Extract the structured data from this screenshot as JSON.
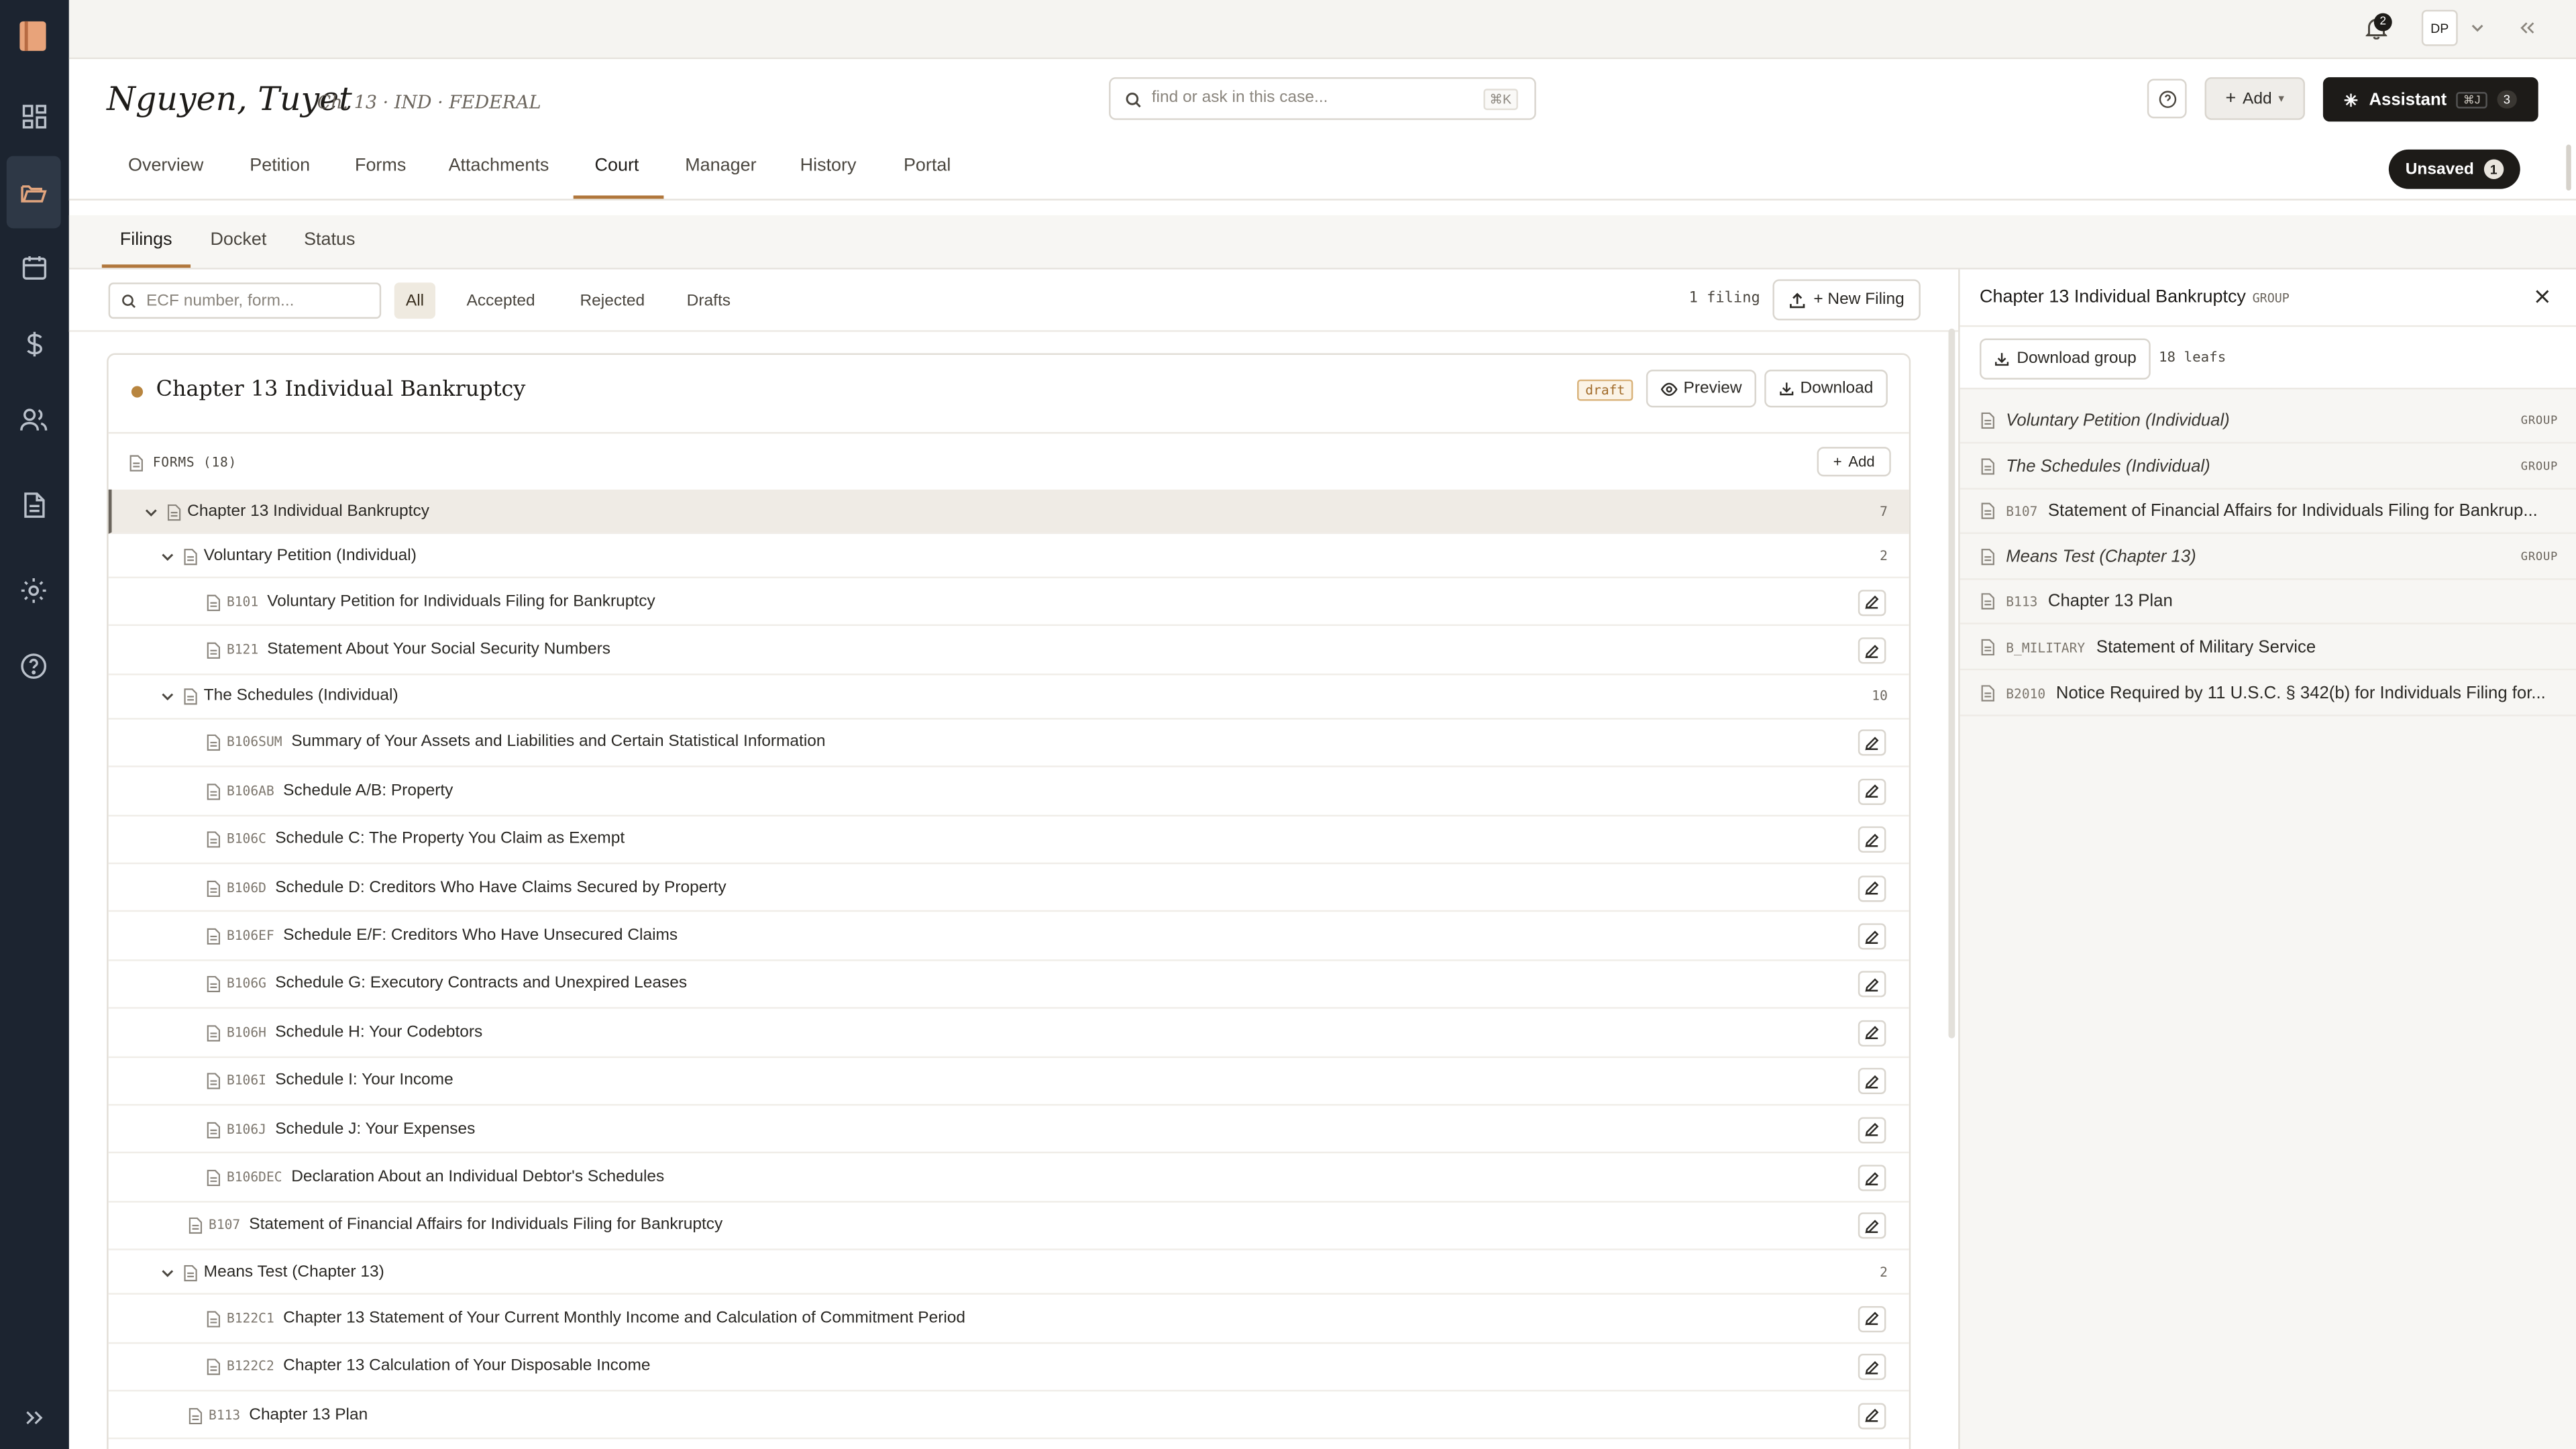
{
  "notifications": {
    "count": "2"
  },
  "user": {
    "initials": "DP"
  },
  "case": {
    "name": "Nguyen, Tuyet",
    "subtitle": "Ch. 13 · IND · FEDERAL"
  },
  "search": {
    "placeholder": "find or ask in this case...",
    "shortcut": "⌘K"
  },
  "header": {
    "add_label": "Add",
    "assistant_label": "Assistant",
    "assistant_shortcut": "⌘J",
    "assistant_count": "3",
    "unsaved_label": "Unsaved",
    "unsaved_count": "1"
  },
  "tabs": [
    "Overview",
    "Petition",
    "Forms",
    "Attachments",
    "Court",
    "Manager",
    "History",
    "Portal"
  ],
  "active_tab": "Court",
  "subtabs": [
    "Filings",
    "Docket",
    "Status"
  ],
  "active_subtab": "Filings",
  "filters": {
    "placeholder": "ECF number, form...",
    "options": [
      "All",
      "Accepted",
      "Rejected",
      "Drafts"
    ],
    "active": "All",
    "count": "1 filing",
    "new_filing": "+ New Filing"
  },
  "filing": {
    "title": "Chapter 13 Individual Bankruptcy",
    "status": "draft",
    "preview_label": "Preview",
    "download_label": "Download",
    "forms_header": "FORMS (18)",
    "add_label": "Add"
  },
  "tree": [
    {
      "level": 0,
      "type": "group",
      "label": "Chapter 13 Individual Bankruptcy",
      "count": "7",
      "selected": true
    },
    {
      "level": 1,
      "type": "group",
      "label": "Voluntary Petition (Individual)",
      "count": "2"
    },
    {
      "level": 2,
      "type": "leaf",
      "code": "B101",
      "label": "Voluntary Petition for Individuals Filing for Bankruptcy"
    },
    {
      "level": 2,
      "type": "leaf",
      "code": "B121",
      "label": "Statement About Your Social Security Numbers"
    },
    {
      "level": 1,
      "type": "group",
      "label": "The Schedules (Individual)",
      "count": "10"
    },
    {
      "level": 2,
      "type": "leaf",
      "code": "B106SUM",
      "label": "Summary of Your Assets and Liabilities and Certain Statistical Information"
    },
    {
      "level": 2,
      "type": "leaf",
      "code": "B106AB",
      "label": "Schedule A/B: Property"
    },
    {
      "level": 2,
      "type": "leaf",
      "code": "B106C",
      "label": "Schedule C: The Property You Claim as Exempt"
    },
    {
      "level": 2,
      "type": "leaf",
      "code": "B106D",
      "label": "Schedule D: Creditors Who Have Claims Secured by Property"
    },
    {
      "level": 2,
      "type": "leaf",
      "code": "B106EF",
      "label": "Schedule E/F: Creditors Who Have Unsecured Claims"
    },
    {
      "level": 2,
      "type": "leaf",
      "code": "B106G",
      "label": "Schedule G: Executory Contracts and Unexpired Leases"
    },
    {
      "level": 2,
      "type": "leaf",
      "code": "B106H",
      "label": "Schedule H: Your Codebtors"
    },
    {
      "level": 2,
      "type": "leaf",
      "code": "B106I",
      "label": "Schedule I: Your Income"
    },
    {
      "level": 2,
      "type": "leaf",
      "code": "B106J",
      "label": "Schedule J: Your Expenses"
    },
    {
      "level": 2,
      "type": "leaf",
      "code": "B106DEC",
      "label": "Declaration About an Individual Debtor's Schedules"
    },
    {
      "level": 1,
      "type": "leaf",
      "code": "B107",
      "label": "Statement of Financial Affairs for Individuals Filing for Bankruptcy"
    },
    {
      "level": 1,
      "type": "group",
      "label": "Means Test (Chapter 13)",
      "count": "2"
    },
    {
      "level": 2,
      "type": "leaf",
      "code": "B122C1",
      "label": "Chapter 13 Statement of Your Current Monthly Income and Calculation of Commitment Period"
    },
    {
      "level": 2,
      "type": "leaf",
      "code": "B122C2",
      "label": "Chapter 13 Calculation of Your Disposable Income"
    },
    {
      "level": 1,
      "type": "leaf",
      "code": "B113",
      "label": "Chapter 13 Plan"
    }
  ],
  "panel": {
    "title": "Chapter 13 Individual Bankruptcy",
    "tag": "GROUP",
    "download_group": "Download group",
    "leafs": "18 leafs",
    "items": [
      {
        "type": "group",
        "label": "Voluntary Petition (Individual)",
        "tag": "GROUP"
      },
      {
        "type": "group",
        "label": "The Schedules (Individual)",
        "tag": "GROUP"
      },
      {
        "type": "leaf",
        "code": "B107",
        "label": "Statement of Financial Affairs for Individuals Filing for Bankrup..."
      },
      {
        "type": "group",
        "label": "Means Test (Chapter 13)",
        "tag": "GROUP"
      },
      {
        "type": "leaf",
        "code": "B113",
        "label": "Chapter 13 Plan"
      },
      {
        "type": "leaf",
        "code": "B_MILITARY",
        "label": "Statement of Military Service"
      },
      {
        "type": "leaf",
        "code": "B2010",
        "label": "Notice Required by 11 U.S.C. § 342(b) for Individuals Filing for..."
      }
    ]
  },
  "colors": {
    "rail": "#1c2430",
    "accent": "#b0763b",
    "dark_button": "#1d1b18"
  }
}
